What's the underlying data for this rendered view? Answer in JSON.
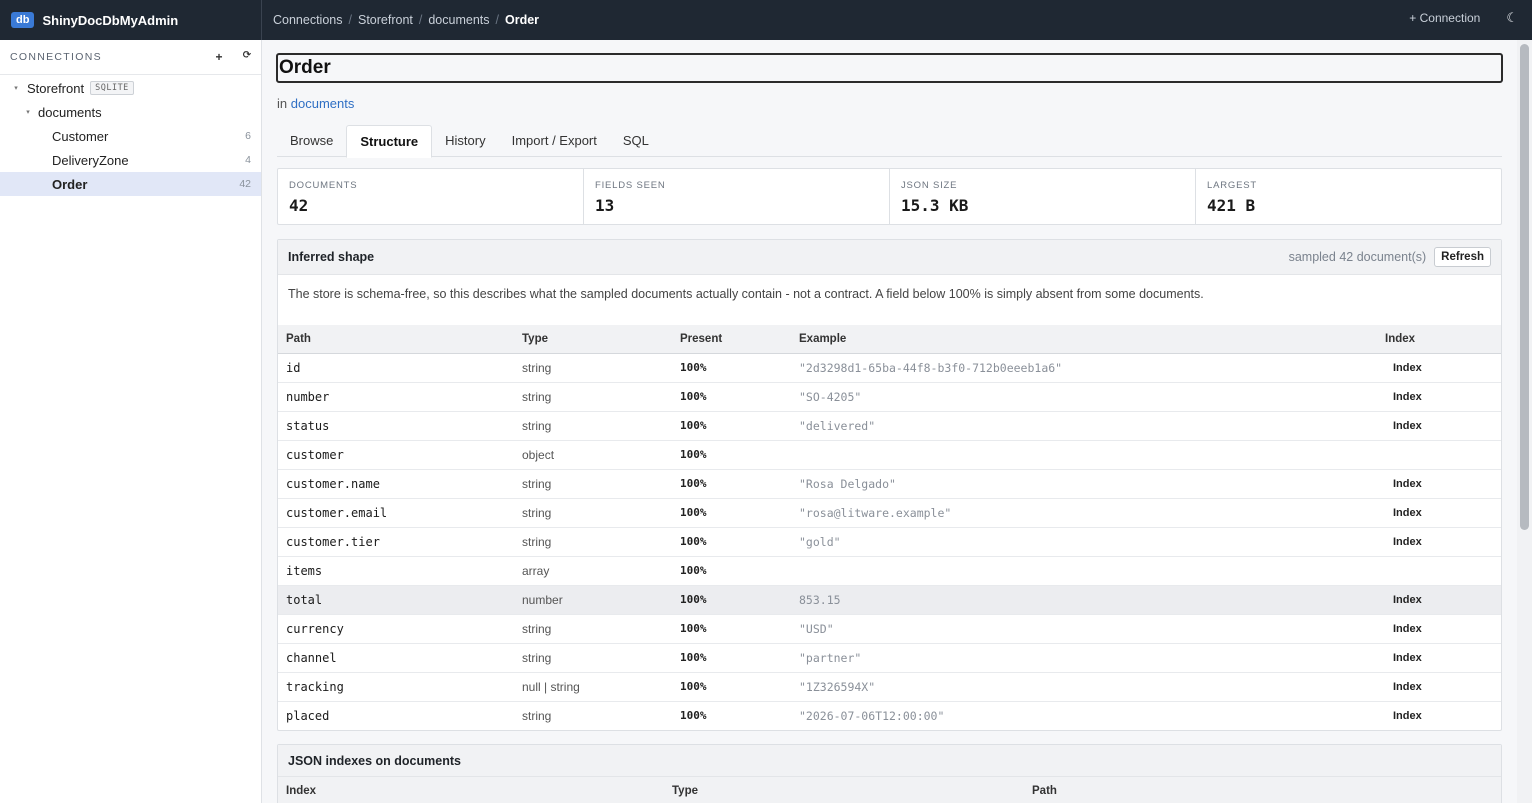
{
  "app": {
    "logo": "db",
    "name": "ShinyDocDbMyAdmin"
  },
  "breadcrumb": {
    "items": [
      "Connections",
      "Storefront",
      "documents"
    ],
    "current": "Order"
  },
  "topbar": {
    "add_connection": "+ Connection",
    "theme_icon": "moon-icon"
  },
  "sidebar": {
    "heading": "CONNECTIONS",
    "add": "+",
    "refresh": "⟳",
    "connection": {
      "name": "Storefront",
      "badge": "SQLITE"
    },
    "folder": "documents",
    "collections": [
      {
        "name": "Customer",
        "count": "6"
      },
      {
        "name": "DeliveryZone",
        "count": "4"
      },
      {
        "name": "Order",
        "count": "42"
      }
    ]
  },
  "main": {
    "title": "Order",
    "in_prefix": "in",
    "in_link": "documents",
    "tabs": [
      "Browse",
      "Structure",
      "History",
      "Import / Export",
      "SQL"
    ],
    "active_tab": "Structure",
    "stats": [
      {
        "label": "DOCUMENTS",
        "value": "42"
      },
      {
        "label": "FIELDS SEEN",
        "value": "13"
      },
      {
        "label": "JSON SIZE",
        "value": "15.3 KB"
      },
      {
        "label": "LARGEST",
        "value": "421 B"
      }
    ],
    "shape": {
      "title": "Inferred shape",
      "sampled": "sampled 42 document(s)",
      "refresh": "Refresh",
      "note": "The store is schema-free, so this describes what the sampled documents actually contain - not a contract. A field below 100% is simply absent from some documents.",
      "columns": [
        "Path",
        "Type",
        "Present",
        "Example",
        "Index"
      ],
      "rows": [
        {
          "path": "id",
          "type": "string",
          "present": "100%",
          "example": "\"2d3298d1-65ba-44f8-b3f0-712b0eeeb1a6\"",
          "index": "Index"
        },
        {
          "path": "number",
          "type": "string",
          "present": "100%",
          "example": "\"SO-4205\"",
          "index": "Index"
        },
        {
          "path": "status",
          "type": "string",
          "present": "100%",
          "example": "\"delivered\"",
          "index": "Index"
        },
        {
          "path": "customer",
          "type": "object",
          "present": "100%",
          "example": "",
          "index": ""
        },
        {
          "path": "customer.name",
          "type": "string",
          "present": "100%",
          "example": "\"Rosa Delgado\"",
          "index": "Index"
        },
        {
          "path": "customer.email",
          "type": "string",
          "present": "100%",
          "example": "\"rosa@litware.example\"",
          "index": "Index"
        },
        {
          "path": "customer.tier",
          "type": "string",
          "present": "100%",
          "example": "\"gold\"",
          "index": "Index"
        },
        {
          "path": "items",
          "type": "array",
          "present": "100%",
          "example": "",
          "index": ""
        },
        {
          "path": "total",
          "type": "number",
          "present": "100%",
          "example": "853.15",
          "index": "Index"
        },
        {
          "path": "currency",
          "type": "string",
          "present": "100%",
          "example": "\"USD\"",
          "index": "Index"
        },
        {
          "path": "channel",
          "type": "string",
          "present": "100%",
          "example": "\"partner\"",
          "index": "Index"
        },
        {
          "path": "tracking",
          "type": "null | string",
          "present": "100%",
          "example": "\"1Z326594X\"",
          "index": "Index"
        },
        {
          "path": "placed",
          "type": "string",
          "present": "100%",
          "example": "\"2026-07-06T12:00:00\"",
          "index": "Index"
        }
      ]
    },
    "json_indexes": {
      "title": "JSON indexes on documents",
      "columns": [
        "Index",
        "Type",
        "Path"
      ]
    }
  }
}
